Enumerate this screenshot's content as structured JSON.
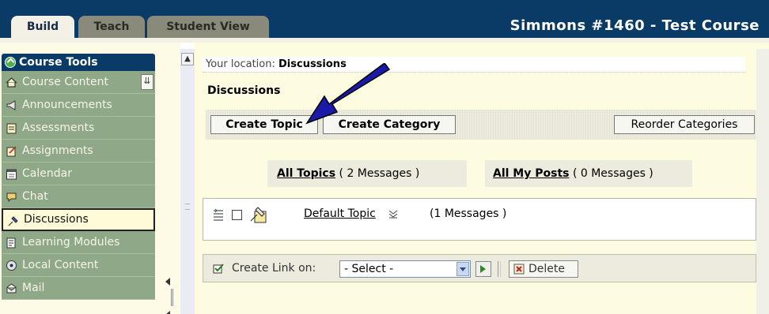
{
  "header": {
    "tabs": [
      {
        "label": "Build",
        "active": true
      },
      {
        "label": "Teach",
        "active": false
      },
      {
        "label": "Student View",
        "active": false
      }
    ],
    "course_title": "Simmons #1460 - Test Course"
  },
  "sidebar": {
    "title": "Course Tools",
    "items": [
      {
        "label": "Course Content",
        "icon": "home-icon"
      },
      {
        "label": "Announcements",
        "icon": "megaphone-icon"
      },
      {
        "label": "Assessments",
        "icon": "assessment-icon"
      },
      {
        "label": "Assignments",
        "icon": "assignment-icon"
      },
      {
        "label": "Calendar",
        "icon": "calendar-icon"
      },
      {
        "label": "Chat",
        "icon": "chat-bubble-icon"
      },
      {
        "label": "Discussions",
        "icon": "pushpin-icon",
        "active": true
      },
      {
        "label": "Learning Modules",
        "icon": "module-icon"
      },
      {
        "label": "Local Content",
        "icon": "disc-icon"
      },
      {
        "label": "Mail",
        "icon": "mail-icon"
      }
    ]
  },
  "main": {
    "location_prefix": "Your location:",
    "location_current": "Discussions",
    "page_title": "Discussions",
    "buttons": {
      "create_topic": "Create Topic",
      "create_category": "Create Category",
      "reorder_categories": "Reorder Categories"
    },
    "filters": {
      "all_topics_label": "All Topics",
      "all_topics_count": "( 2 Messages )",
      "my_posts_label": "All My Posts",
      "my_posts_count": "( 0 Messages )"
    },
    "topics": [
      {
        "name": "Default Topic",
        "messages": "(1 Messages )"
      }
    ],
    "actions": {
      "create_link_label": "Create Link on:",
      "select_value": "- Select -",
      "delete_label": "Delete"
    }
  },
  "colors": {
    "header_bg": "#0a3a66",
    "sidebar_item_bg": "#8fa888",
    "content_bg": "#fdfbe0",
    "arrow": "#1a1aa8"
  }
}
